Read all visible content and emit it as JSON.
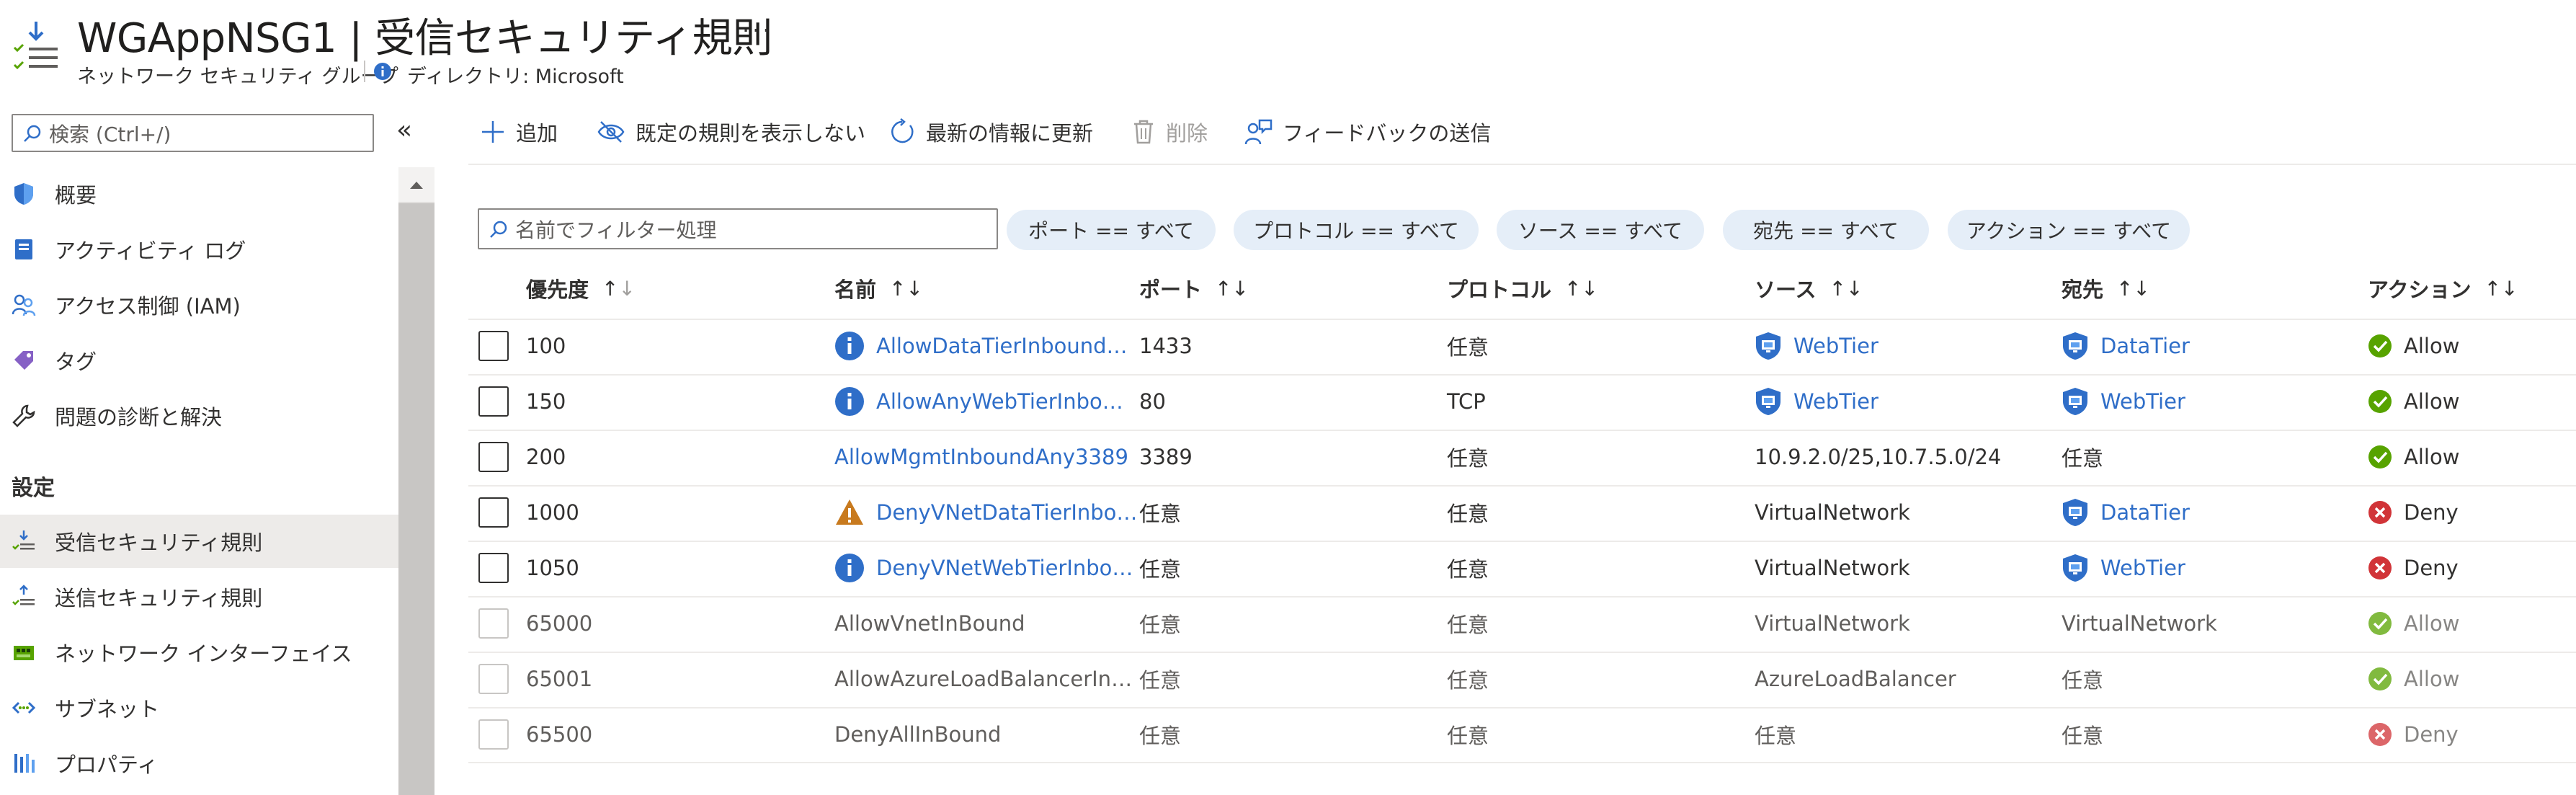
{
  "header": {
    "title": "WGAppNSG1 | 受信セキュリティ規則",
    "more": "...",
    "subtitle": "ネットワーク セキュリティ グループ",
    "directory": "ディレクトリ: Microsoft"
  },
  "sidebar": {
    "search_placeholder": "検索 (Ctrl+/)",
    "collapse": "«",
    "section_settings": "設定",
    "items": [
      {
        "label": "概要",
        "icon": "shield-icon"
      },
      {
        "label": "アクティビティ ログ",
        "icon": "activity-log-icon"
      },
      {
        "label": "アクセス制御 (IAM)",
        "icon": "people-icon"
      },
      {
        "label": "タグ",
        "icon": "tag-icon"
      },
      {
        "label": "問題の診断と解決",
        "icon": "wrench-icon"
      },
      {
        "label": "受信セキュリティ規則",
        "icon": "inbound-rules-icon"
      },
      {
        "label": "送信セキュリティ規則",
        "icon": "outbound-rules-icon"
      },
      {
        "label": "ネットワーク インターフェイス",
        "icon": "network-interface-icon"
      },
      {
        "label": "サブネット",
        "icon": "subnet-icon"
      },
      {
        "label": "プロパティ",
        "icon": "properties-icon"
      }
    ]
  },
  "toolbar": {
    "add": "追加",
    "hide_defaults": "既定の規則を表示しない",
    "refresh": "最新の情報に更新",
    "delete": "削除",
    "feedback": "フィードバックの送信"
  },
  "filters": {
    "name_placeholder": "名前でフィルター処理",
    "pills": [
      "ポート == すべて",
      "プロトコル == すべて",
      "ソース == すべて",
      "宛先 == すべて",
      "アクション == すべて"
    ]
  },
  "table": {
    "columns": [
      "優先度",
      "名前",
      "ポート",
      "プロトコル",
      "ソース",
      "宛先",
      "アクション"
    ],
    "rows": [
      {
        "priority": "100",
        "name": "AllowDataTierInbound…",
        "name_icon": "info-icon",
        "port": "1433",
        "protocol": "任意",
        "source": "WebTier",
        "source_icon": "asg-icon",
        "dest": "DataTier",
        "dest_icon": "asg-icon",
        "action": "Allow"
      },
      {
        "priority": "150",
        "name": "AllowAnyWebTierInbo…",
        "name_icon": "info-icon",
        "port": "80",
        "protocol": "TCP",
        "source": "WebTier",
        "source_icon": "asg-icon",
        "dest": "WebTier",
        "dest_icon": "asg-icon",
        "action": "Allow"
      },
      {
        "priority": "200",
        "name": "AllowMgmtInboundAny3389",
        "name_icon": "",
        "port": "3389",
        "protocol": "任意",
        "source": "10.9.2.0/25,10.7.5.0/24",
        "source_icon": "",
        "dest": "任意",
        "dest_icon": "",
        "action": "Allow"
      },
      {
        "priority": "1000",
        "name": "DenyVNetDataTierInbo…",
        "name_icon": "warning-icon",
        "port": "任意",
        "protocol": "任意",
        "source": "VirtualNetwork",
        "source_icon": "",
        "dest": "DataTier",
        "dest_icon": "asg-icon",
        "action": "Deny"
      },
      {
        "priority": "1050",
        "name": "DenyVNetWebTierInbo…",
        "name_icon": "info-icon",
        "port": "任意",
        "protocol": "任意",
        "source": "VirtualNetwork",
        "source_icon": "",
        "dest": "WebTier",
        "dest_icon": "asg-icon",
        "action": "Deny"
      },
      {
        "priority": "65000",
        "name": "AllowVnetInBound",
        "name_icon": "",
        "port": "任意",
        "protocol": "任意",
        "source": "VirtualNetwork",
        "source_icon": "",
        "dest": "VirtualNetwork",
        "dest_icon": "",
        "action": "Allow"
      },
      {
        "priority": "65001",
        "name": "AllowAzureLoadBalancerIn…",
        "name_icon": "",
        "port": "任意",
        "protocol": "任意",
        "source": "AzureLoadBalancer",
        "source_icon": "",
        "dest": "任意",
        "dest_icon": "",
        "action": "Allow"
      },
      {
        "priority": "65500",
        "name": "DenyAllInBound",
        "name_icon": "",
        "port": "任意",
        "protocol": "任意",
        "source": "任意",
        "source_icon": "",
        "dest": "任意",
        "dest_icon": "",
        "action": "Deny"
      }
    ]
  },
  "colors": {
    "link": "#2f6ec8",
    "allow": "#57a300",
    "deny": "#d13438",
    "warning": "#c87a1e",
    "info": "#2f6ec8",
    "selected": "#edebe9"
  }
}
